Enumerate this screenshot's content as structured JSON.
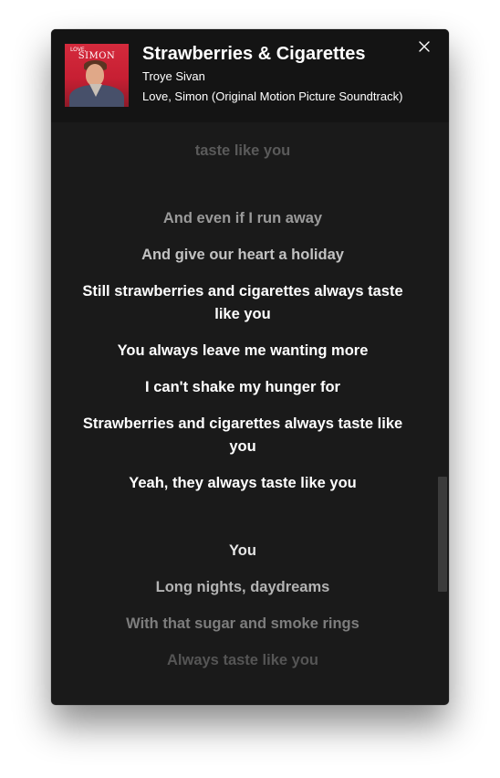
{
  "track": {
    "title": "Strawberries & Cigarettes",
    "artist": "Troye Sivan",
    "album": "Love, Simon (Original Motion Picture Soundtrack)"
  },
  "cover_art": {
    "top_text": "LOVE,",
    "main_text": "SIMON"
  },
  "lyrics": [
    {
      "text": "taste like you",
      "color": "#5a5a5a"
    },
    {
      "text": "And even if I run away",
      "color": "#9a9a9a"
    },
    {
      "text": "And give our heart a holiday",
      "color": "#c2c2c2"
    },
    {
      "text": "Still strawberries and cigarettes always taste like you",
      "color": "#ffffff"
    },
    {
      "text": "You always leave me wanting more",
      "color": "#ffffff"
    },
    {
      "text": "I can't shake my hunger for",
      "color": "#ffffff"
    },
    {
      "text": "Strawberries and cigarettes always taste like you",
      "color": "#ffffff"
    },
    {
      "text": "Yeah, they always taste like you",
      "color": "#ffffff"
    },
    {
      "text": "You",
      "color": "#e6e6e6"
    },
    {
      "text": "Long nights, daydreams",
      "color": "#b3b3b3"
    },
    {
      "text": "With that sugar and smoke rings",
      "color": "#7d7d7d"
    },
    {
      "text": "Always taste like you",
      "color": "#555555"
    }
  ],
  "icons": {
    "close": "close-icon"
  }
}
